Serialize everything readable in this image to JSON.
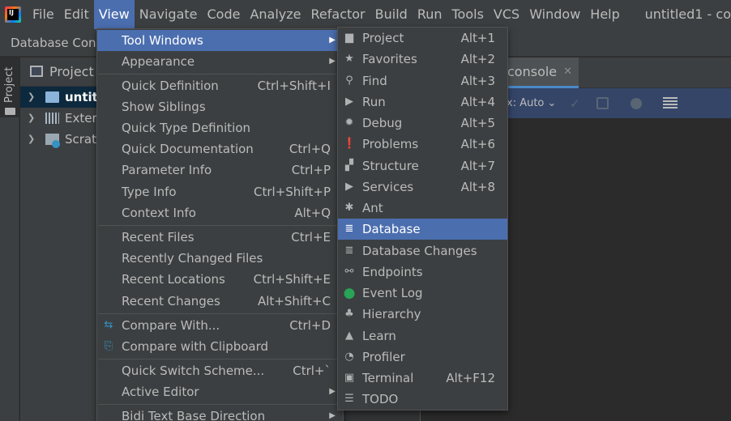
{
  "app": {
    "window_title": "untitled1 - co",
    "logo_text": "IJ"
  },
  "menubar": {
    "items": [
      {
        "id": "file",
        "label": "File"
      },
      {
        "id": "edit",
        "label": "Edit"
      },
      {
        "id": "view",
        "label": "View"
      },
      {
        "id": "navigate",
        "label": "Navigate"
      },
      {
        "id": "code",
        "label": "Code"
      },
      {
        "id": "analyze",
        "label": "Analyze"
      },
      {
        "id": "refactor",
        "label": "Refactor"
      },
      {
        "id": "build",
        "label": "Build"
      },
      {
        "id": "run",
        "label": "Run"
      },
      {
        "id": "tools",
        "label": "Tools"
      },
      {
        "id": "vcs",
        "label": "VCS"
      },
      {
        "id": "window",
        "label": "Window"
      },
      {
        "id": "help",
        "label": "Help"
      }
    ]
  },
  "navbar": {
    "crumb": "Database Conso"
  },
  "left_stripe": {
    "project_label": "Project"
  },
  "project_panel": {
    "title": "Project",
    "tree": [
      {
        "label": "untitl",
        "selected": true
      },
      {
        "label": "Extern",
        "selected": false
      },
      {
        "label": "Scrato",
        "selected": false
      }
    ]
  },
  "editor": {
    "tab_label": "console",
    "tab_close": "✕",
    "tx_mode": "x: Auto ⌄",
    "check_glyph": "✓"
  },
  "view_menu": {
    "items": [
      {
        "label": "Tool Windows",
        "shortcut": "",
        "submenu": true,
        "highlight": true
      },
      {
        "label": "Appearance",
        "shortcut": "",
        "submenu": true
      },
      {
        "label": "Quick Definition",
        "shortcut": "Ctrl+Shift+I"
      },
      {
        "label": "Show Siblings",
        "shortcut": ""
      },
      {
        "label": "Quick Type Definition",
        "shortcut": ""
      },
      {
        "label": "Quick Documentation",
        "shortcut": "Ctrl+Q"
      },
      {
        "label": "Parameter Info",
        "shortcut": "Ctrl+P"
      },
      {
        "label": "Type Info",
        "shortcut": "Ctrl+Shift+P"
      },
      {
        "label": "Context Info",
        "shortcut": "Alt+Q"
      },
      {
        "label": "Recent Files",
        "shortcut": "Ctrl+E"
      },
      {
        "label": "Recently Changed Files",
        "shortcut": ""
      },
      {
        "label": "Recent Locations",
        "shortcut": "Ctrl+Shift+E"
      },
      {
        "label": "Recent Changes",
        "shortcut": "Alt+Shift+C"
      },
      {
        "label": "Compare With...",
        "shortcut": "Ctrl+D",
        "icon": "compare-icon"
      },
      {
        "label": "Compare with Clipboard",
        "shortcut": "",
        "icon": "compare-clipboard-icon"
      },
      {
        "label": "Quick Switch Scheme...",
        "shortcut": "Ctrl+`"
      },
      {
        "label": "Active Editor",
        "shortcut": "",
        "submenu": true
      },
      {
        "label": "Bidi Text Base Direction",
        "shortcut": "",
        "submenu": true
      }
    ]
  },
  "tool_windows_menu": {
    "items": [
      {
        "label": "Project",
        "shortcut": "Alt+1",
        "icon": "folder-icon",
        "glyph": "▆"
      },
      {
        "label": "Favorites",
        "shortcut": "Alt+2",
        "icon": "star-icon",
        "glyph": "★"
      },
      {
        "label": "Find",
        "shortcut": "Alt+3",
        "icon": "search-icon",
        "glyph": "⚲"
      },
      {
        "label": "Run",
        "shortcut": "Alt+4",
        "icon": "play-icon",
        "glyph": "▶"
      },
      {
        "label": "Debug",
        "shortcut": "Alt+5",
        "icon": "bug-icon",
        "glyph": "✹"
      },
      {
        "label": "Problems",
        "shortcut": "Alt+6",
        "icon": "warning-icon",
        "glyph": "❗"
      },
      {
        "label": "Structure",
        "shortcut": "Alt+7",
        "icon": "structure-icon",
        "glyph": "▞"
      },
      {
        "label": "Services",
        "shortcut": "Alt+8",
        "icon": "services-icon",
        "glyph": "▶"
      },
      {
        "label": "Ant",
        "shortcut": "",
        "icon": "ant-icon",
        "glyph": "✱"
      },
      {
        "label": "Database",
        "shortcut": "",
        "icon": "database-icon",
        "glyph": "≣",
        "highlight": true
      },
      {
        "label": "Database Changes",
        "shortcut": "",
        "icon": "database-changes-icon",
        "glyph": "≣"
      },
      {
        "label": "Endpoints",
        "shortcut": "",
        "icon": "endpoints-icon",
        "glyph": "⚯"
      },
      {
        "label": "Event Log",
        "shortcut": "",
        "icon": "event-log-icon",
        "glyph": "●"
      },
      {
        "label": "Hierarchy",
        "shortcut": "",
        "icon": "hierarchy-icon",
        "glyph": "♣"
      },
      {
        "label": "Learn",
        "shortcut": "",
        "icon": "learn-icon",
        "glyph": "▲"
      },
      {
        "label": "Profiler",
        "shortcut": "",
        "icon": "profiler-icon",
        "glyph": "◔"
      },
      {
        "label": "Terminal",
        "shortcut": "Alt+F12",
        "icon": "terminal-icon",
        "glyph": "▣"
      },
      {
        "label": "TODO",
        "shortcut": "",
        "icon": "todo-icon",
        "glyph": "☰"
      }
    ]
  },
  "colors": {
    "highlight": "#4b6eaf",
    "menu_bg": "#3c3f41",
    "event_log_green": "#29a355"
  }
}
